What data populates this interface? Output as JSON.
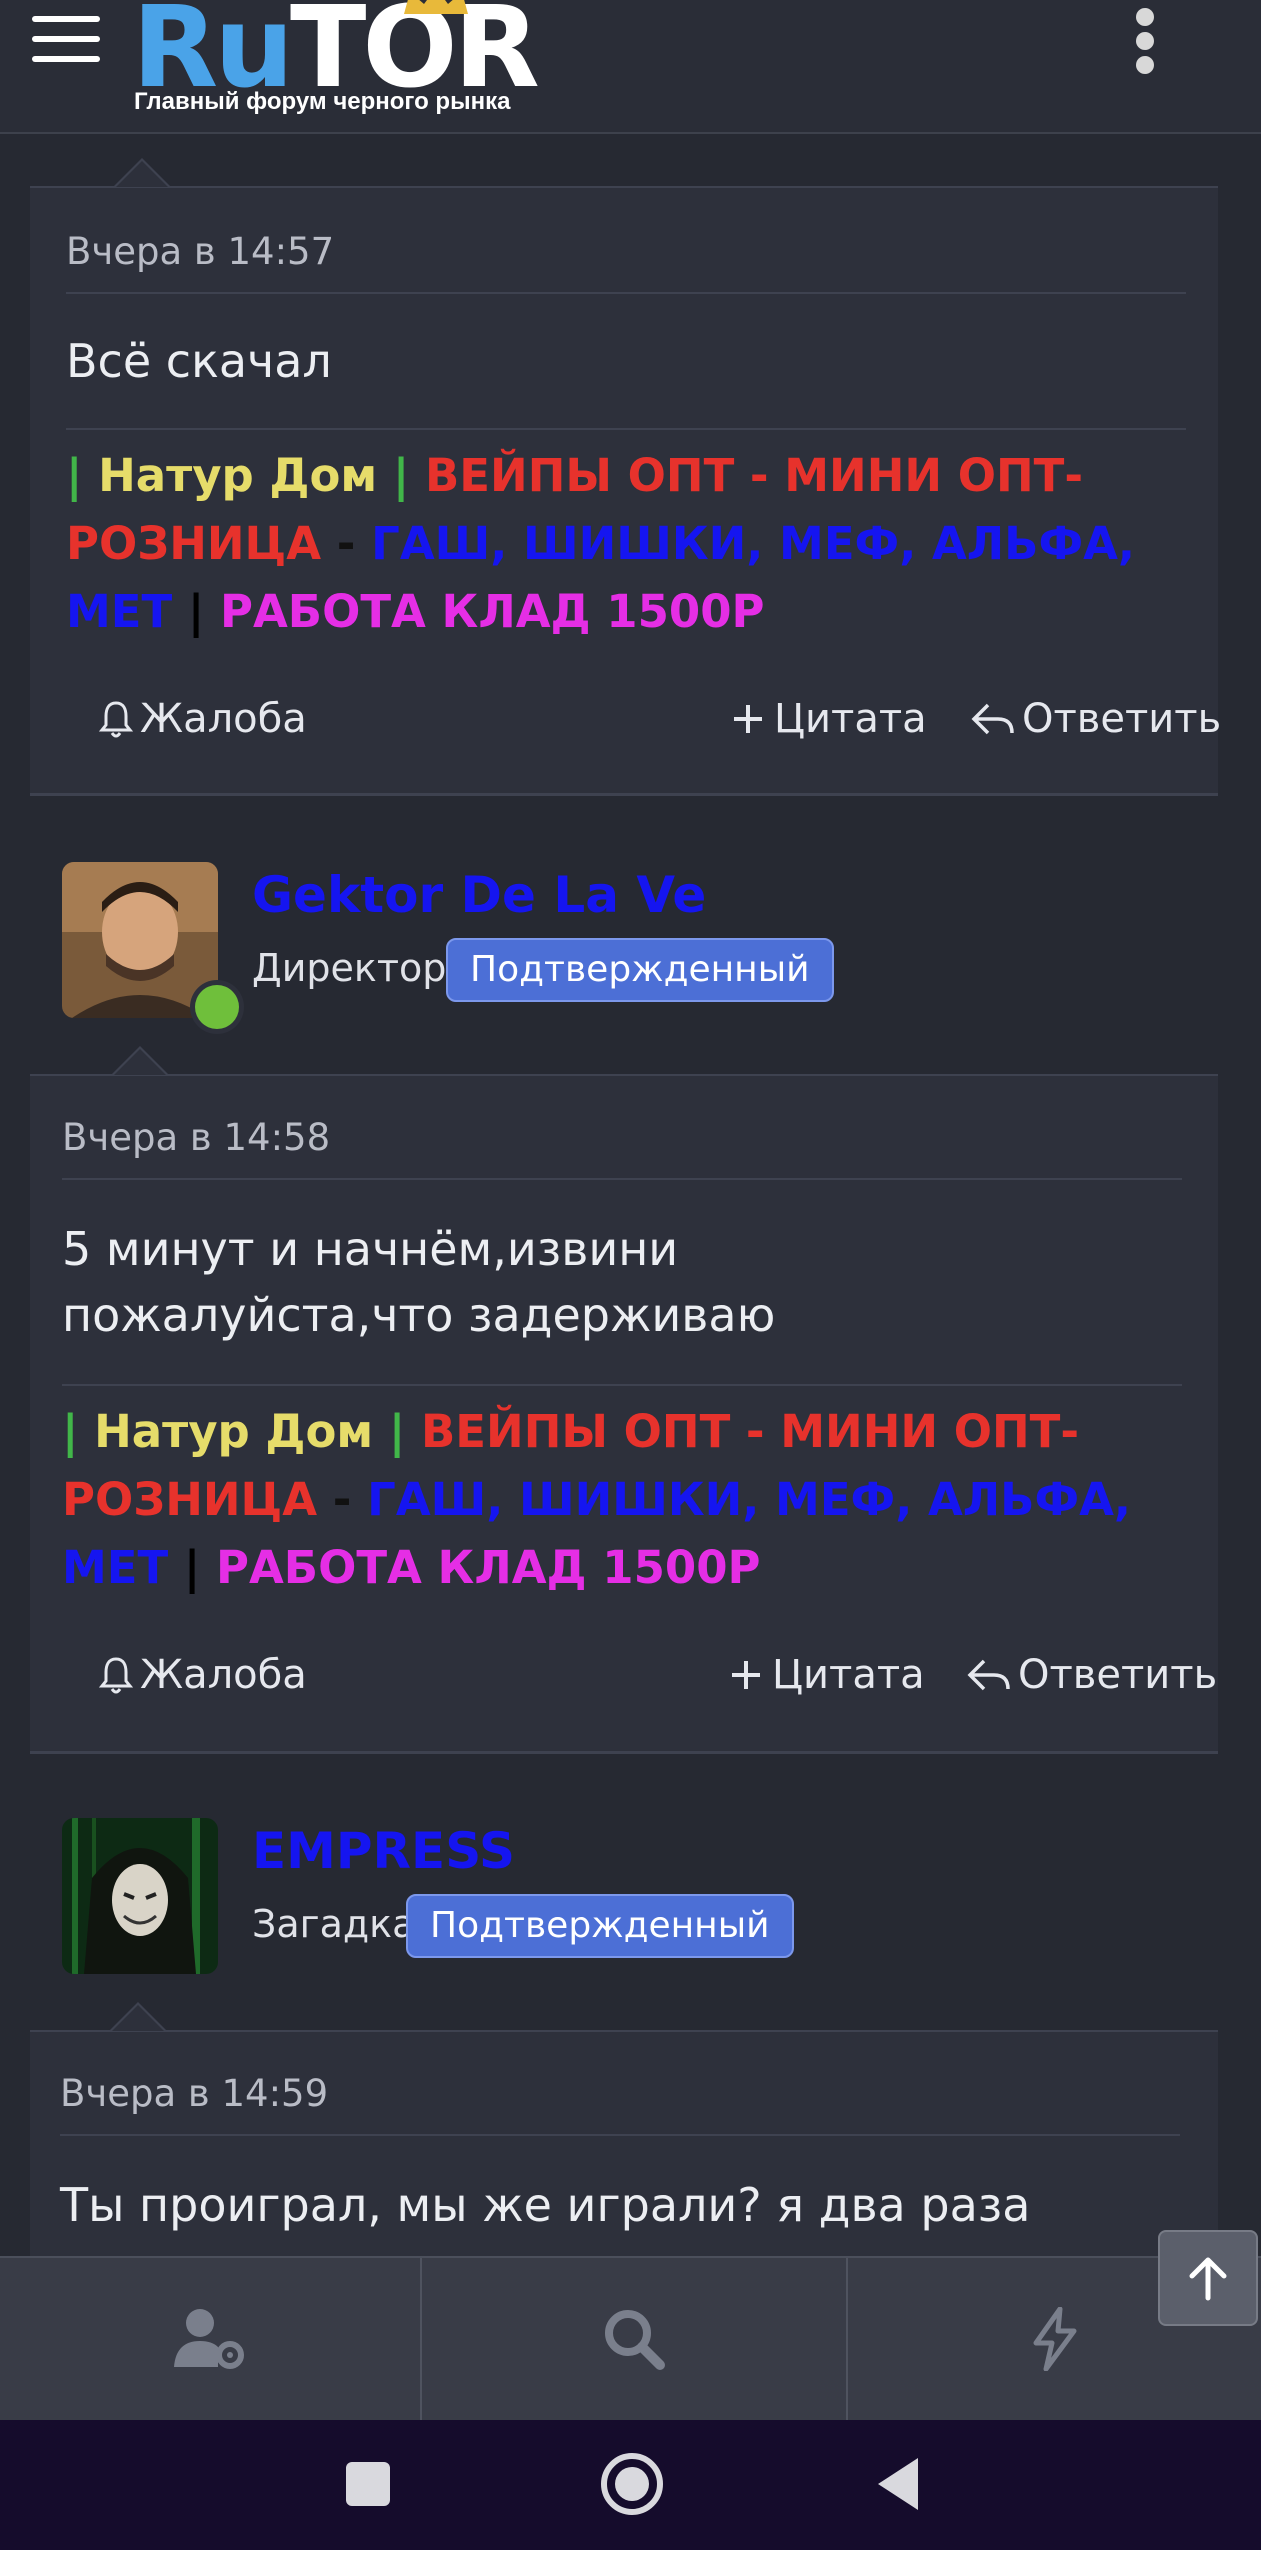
{
  "header": {
    "logo_ru": "Ru",
    "logo_tor": "TOR",
    "logo_subtitle": "Главный форум черного рынка",
    "menu_icon": "hamburger-icon",
    "more_icon": "kebab-icon"
  },
  "signature": {
    "sep1": "|",
    "shop": "Натур Дом",
    "sep2": "|",
    "wholesale": "ВЕЙПЫ ОПТ - МИНИ ОПТ-РОЗНИЦА",
    "dash": "-",
    "goods": "ГАШ, ШИШКИ, МЕФ, АЛЬФА, МЕТ",
    "sep3": "|",
    "job": "РАБОТА КЛАД 1500Р"
  },
  "actions": {
    "report": "Жалоба",
    "quote": "Цитата",
    "reply": "Ответить"
  },
  "posts": [
    {
      "time": "Вчера в 14:57",
      "body": "Всё скачал"
    },
    {
      "author": "Gektor De La Ve",
      "role": "Директор",
      "badge": "Подтвержденный",
      "time": "Вчера в 14:58",
      "body": "5 минут и начнём,извини пожалуйста,что задерживаю"
    },
    {
      "author": "EMPRESS",
      "role": "Загадка",
      "badge": "Подтвержденный",
      "time": "Вчера в 14:59",
      "body": "Ты проиграл, мы же играли? я два раза"
    }
  ],
  "bottom_nav": {
    "icons": [
      "user-settings-icon",
      "search-icon",
      "lightning-icon"
    ],
    "scroll_top_icon": "arrow-up-icon"
  },
  "colors": {
    "background": "#262932",
    "post_background": "#2d303b",
    "username": "#1515f0",
    "badge": "#4c6fd6",
    "online": "#6fbf3b"
  }
}
